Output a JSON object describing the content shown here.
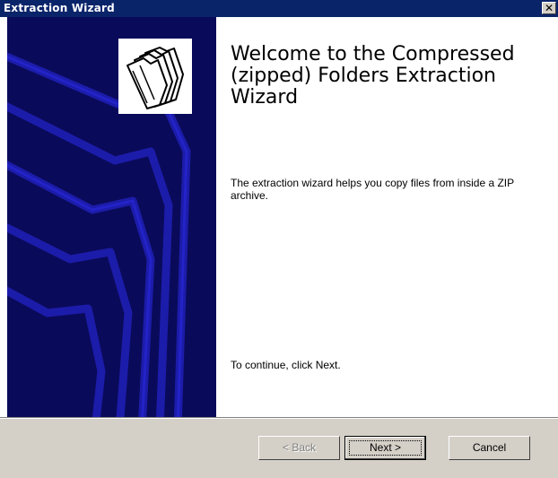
{
  "window": {
    "title": "Extraction Wizard",
    "close_glyph": "✕"
  },
  "main": {
    "heading": "Welcome to the Compressed (zipped) Folders Extraction Wizard",
    "description": "The extraction wizard helps you copy files from inside a ZIP archive.",
    "continue_text": "To continue, click Next.",
    "logo_icon": "zipped-folders-icon"
  },
  "buttons": {
    "back_label": "< Back",
    "next_label": "Next >",
    "cancel_label": "Cancel"
  },
  "colors": {
    "titlebar": "#0a246a",
    "side_panel": "#0a0a5a",
    "dialog_face": "#d4d0c8"
  }
}
